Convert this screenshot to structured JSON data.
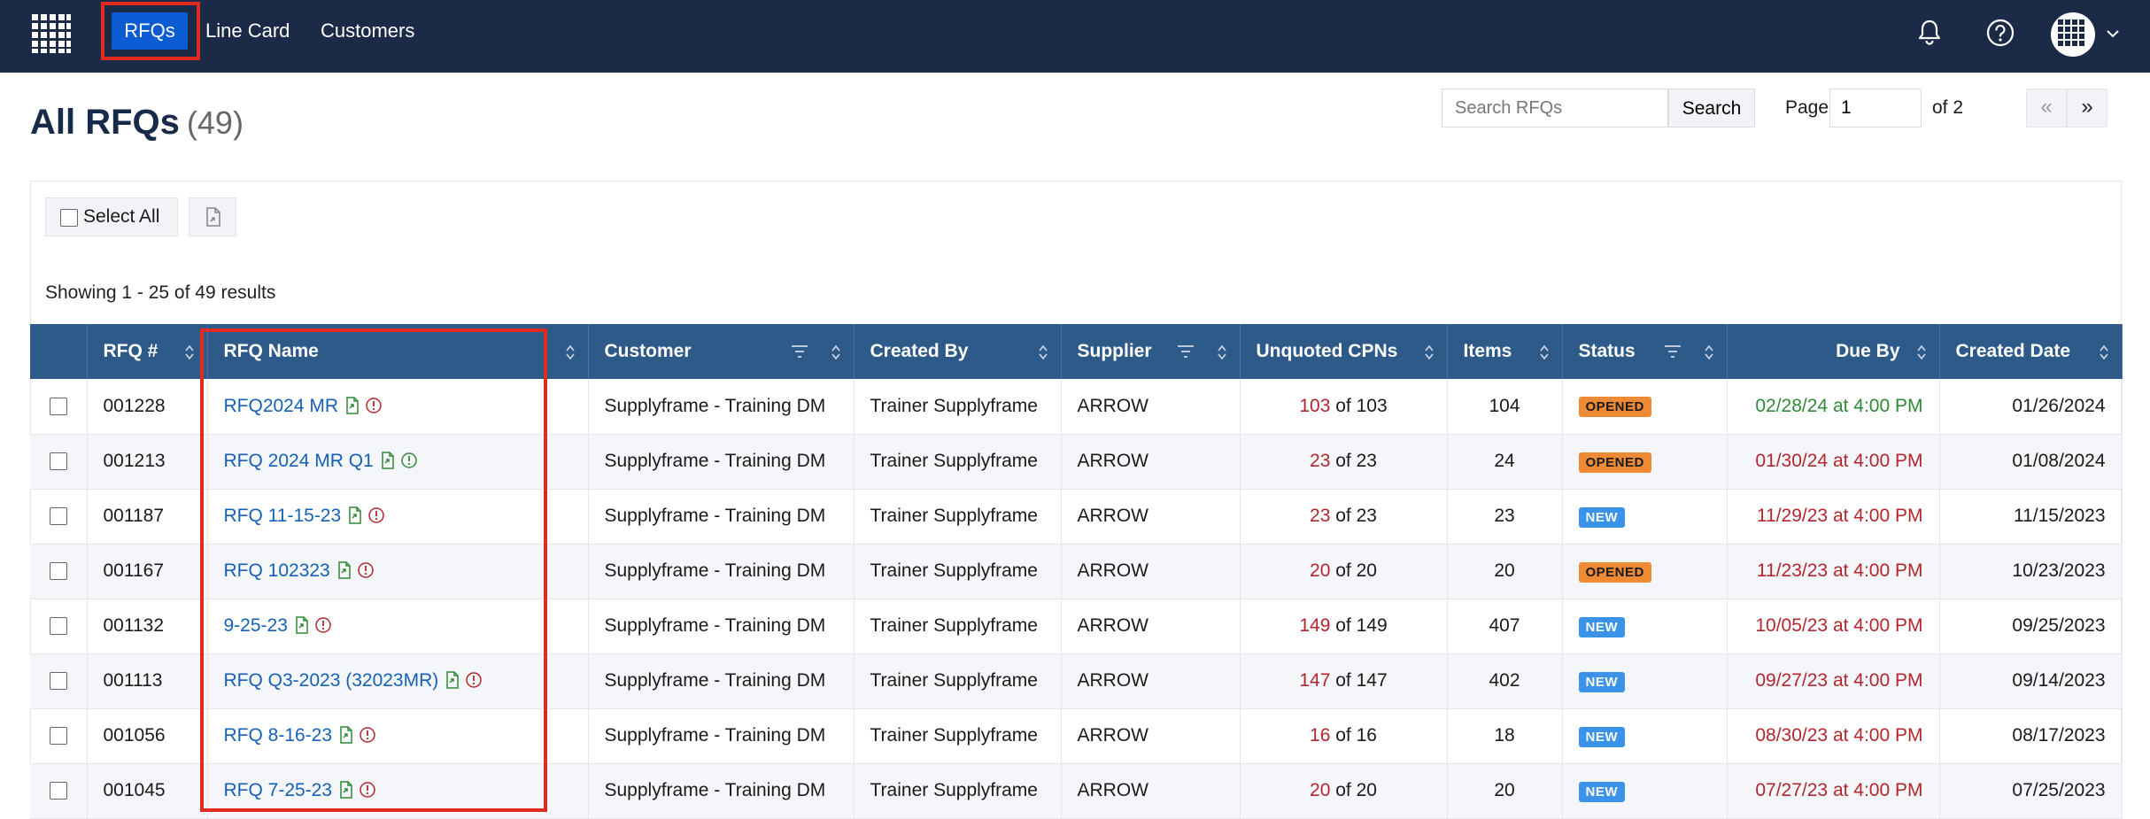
{
  "nav": {
    "items": [
      {
        "label": "RFQs",
        "active": true
      },
      {
        "label": "Line Card"
      },
      {
        "label": "Customers"
      }
    ]
  },
  "header": {
    "icons": [
      "grid-logo-icon",
      "bell-icon",
      "help-icon",
      "avatar",
      "chevron-down-icon"
    ]
  },
  "page": {
    "title": "All RFQs",
    "count": "(49)"
  },
  "toolbar": {
    "select_all_label": "Select All"
  },
  "results": {
    "showing": "Showing 1 - 25 of 49 results",
    "search_placeholder": "Search RFQs",
    "search_button": "Search",
    "page_label": "Page",
    "page_value": "1",
    "page_of": "of 2",
    "prev": "«",
    "next": "»"
  },
  "table": {
    "columns": [
      "RFQ #",
      "RFQ Name",
      "Customer",
      "Created By",
      "Supplier",
      "Unquoted CPNs",
      "Items",
      "Status",
      "Due By",
      "Created Date"
    ],
    "rows": [
      {
        "num": "001228",
        "name": "RFQ2024 MR",
        "info": "red",
        "customer": "Supplyframe - Training DM",
        "created_by": "Trainer Supplyframe",
        "supplier": "ARROW",
        "unq": "103",
        "unq_of": "of 103",
        "items": "104",
        "status": "OPENED",
        "due": "02/28/24 at 4:00 PM",
        "due_color": "green",
        "created": "01/26/2024"
      },
      {
        "num": "001213",
        "name": "RFQ 2024 MR Q1",
        "info": "green",
        "customer": "Supplyframe - Training DM",
        "created_by": "Trainer Supplyframe",
        "supplier": "ARROW",
        "unq": "23",
        "unq_of": "of 23",
        "items": "24",
        "status": "OPENED",
        "due": "01/30/24 at 4:00 PM",
        "due_color": "red",
        "created": "01/08/2024"
      },
      {
        "num": "001187",
        "name": "RFQ 11-15-23",
        "info": "red",
        "customer": "Supplyframe - Training DM",
        "created_by": "Trainer Supplyframe",
        "supplier": "ARROW",
        "unq": "23",
        "unq_of": "of 23",
        "items": "23",
        "status": "NEW",
        "due": "11/29/23 at 4:00 PM",
        "due_color": "red",
        "created": "11/15/2023"
      },
      {
        "num": "001167",
        "name": "RFQ 102323",
        "info": "red",
        "customer": "Supplyframe - Training DM",
        "created_by": "Trainer Supplyframe",
        "supplier": "ARROW",
        "unq": "20",
        "unq_of": "of 20",
        "items": "20",
        "status": "OPENED",
        "due": "11/23/23 at 4:00 PM",
        "due_color": "red",
        "created": "10/23/2023"
      },
      {
        "num": "001132",
        "name": "9-25-23",
        "info": "red",
        "customer": "Supplyframe - Training DM",
        "created_by": "Trainer Supplyframe",
        "supplier": "ARROW",
        "unq": "149",
        "unq_of": "of 149",
        "items": "407",
        "status": "NEW",
        "due": "10/05/23 at 4:00 PM",
        "due_color": "red",
        "created": "09/25/2023"
      },
      {
        "num": "001113",
        "name": "RFQ Q3-2023 (32023MR)",
        "info": "red",
        "customer": "Supplyframe - Training DM",
        "created_by": "Trainer Supplyframe",
        "supplier": "ARROW",
        "unq": "147",
        "unq_of": "of 147",
        "items": "402",
        "status": "NEW",
        "due": "09/27/23 at 4:00 PM",
        "due_color": "red",
        "created": "09/14/2023"
      },
      {
        "num": "001056",
        "name": "RFQ 8-16-23",
        "info": "red",
        "customer": "Supplyframe - Training DM",
        "created_by": "Trainer Supplyframe",
        "supplier": "ARROW",
        "unq": "16",
        "unq_of": "of 16",
        "items": "18",
        "status": "NEW",
        "due": "08/30/23 at 4:00 PM",
        "due_color": "red",
        "created": "08/17/2023"
      },
      {
        "num": "001045",
        "name": "RFQ 7-25-23",
        "info": "red",
        "customer": "Supplyframe - Training DM",
        "created_by": "Trainer Supplyframe",
        "supplier": "ARROW",
        "unq": "20",
        "unq_of": "of 20",
        "items": "20",
        "status": "NEW",
        "due": "07/27/23 at 4:00 PM",
        "due_color": "red",
        "created": "07/25/2023"
      }
    ]
  },
  "colors": {
    "topbar": "#1b2a47",
    "nav_active": "#0b5bd3",
    "table_header": "#2e5a89",
    "link": "#1560b8",
    "highlight": "#e12b1f",
    "opened": "#ef8a34",
    "new": "#3a93e8"
  }
}
